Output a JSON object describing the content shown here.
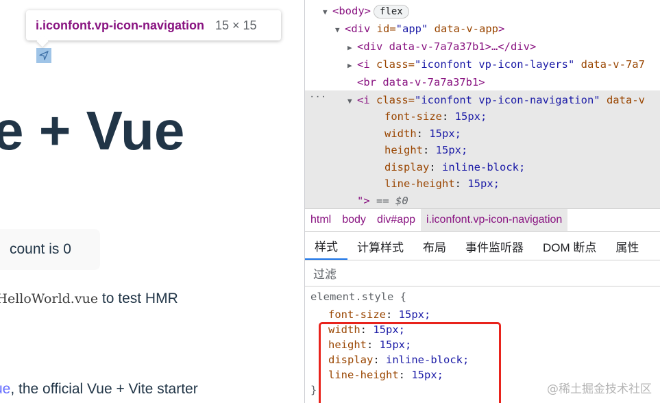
{
  "page": {
    "tooltip": {
      "element": "i.iconfont.vp-icon-navigation",
      "size": "15 × 15"
    },
    "hero_title": "e + Vue",
    "count_button": "count is 0",
    "hmr_code": "/HelloWorld.vue",
    "hmr_text": " to test HMR",
    "starter_link": "ue",
    "starter_text": ", the official Vue + Vite starter"
  },
  "devtools": {
    "dom": {
      "body_tag": "<body>",
      "body_badge": "flex",
      "div_app_open": "<div ",
      "div_app_attr1": "id=",
      "div_app_val1": "\"app\"",
      "div_app_attr2": " data-v-app",
      "div_app_close": ">",
      "child_div": "<div data-v-7a7a37b1>…</div>",
      "i_layers_open": "<i ",
      "i_layers_attr": "class=",
      "i_layers_val": "\"iconfont vp-icon-layers\"",
      "i_layers_tail": " data-v-7a7",
      "br": "<br data-v-7a7a37b1>",
      "i_nav_open": "<i ",
      "i_nav_attr": "class=",
      "i_nav_val": "\"iconfont vp-icon-navigation\"",
      "i_nav_tail": " data-v",
      "inline_styles": [
        {
          "prop": "font-size",
          "value": "15px;"
        },
        {
          "prop": "width",
          "value": "15px;"
        },
        {
          "prop": "height",
          "value": "15px;"
        },
        {
          "prop": "display",
          "value": "inline-block;"
        },
        {
          "prop": "line-height",
          "value": "15px;"
        }
      ],
      "end_quote": "\">",
      "eq_dollar": " == $0",
      "ellipsis": "···"
    },
    "breadcrumbs": [
      "html",
      "body",
      "div#app",
      "i.iconfont.vp-icon-navigation"
    ],
    "tabs": [
      "样式",
      "计算样式",
      "布局",
      "事件监听器",
      "DOM 断点",
      "属性"
    ],
    "filter_placeholder": "过滤",
    "styles": {
      "selector": "element.style {",
      "rules": [
        {
          "prop": "font-size",
          "value": "15px;"
        },
        {
          "prop": "width",
          "value": "15px;"
        },
        {
          "prop": "height",
          "value": "15px;"
        },
        {
          "prop": "display",
          "value": "inline-block;"
        },
        {
          "prop": "line-height",
          "value": "15px;"
        }
      ],
      "closing": "}"
    }
  },
  "watermark": "@稀土掘金技术社区"
}
